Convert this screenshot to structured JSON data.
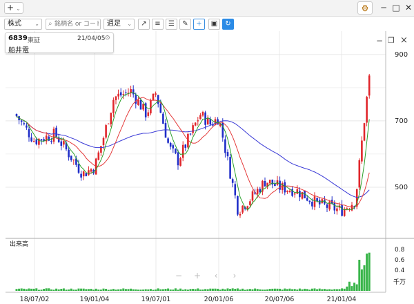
{
  "titlebar": {
    "add_label": "+",
    "gear_icon": "gear-icon",
    "min": "−",
    "max": "□",
    "close": "✕"
  },
  "toolbar": {
    "asset_type": "株式",
    "search_placeholder": "銘柄名 or コード",
    "period": "週足",
    "tools": [
      "trend-line-icon",
      "text-lines-icon",
      "align-icon",
      "pencil-icon",
      "crosshair-icon",
      "camera-icon",
      "refresh-icon"
    ]
  },
  "info": {
    "code": "6839",
    "market": "東証",
    "date": "21/04/05",
    "name": "船井電"
  },
  "volume_label": "出来高",
  "volume_unit": "千万",
  "nav": [
    "−",
    "+",
    "‹",
    "›"
  ],
  "chart_data": [
    {
      "type": "candlestick",
      "title": "",
      "y_ticks": [
        500,
        700,
        900
      ],
      "ylim": [
        350,
        960
      ],
      "x_tick_labels": [
        "18/07/02",
        "19/01/04",
        "19/07/01",
        "20/01/06",
        "20/07/06",
        "21/01/04"
      ],
      "colors": {
        "up": "#e0262b",
        "down": "#1f2dc8",
        "ma_short": "#2aa02a",
        "ma_mid": "#e43b3b",
        "ma_long": "#3a3ad6"
      },
      "ohlc_anchors": [
        {
          "x": "18/04",
          "close": 720
        },
        {
          "x": "18/07/02",
          "close": 640
        },
        {
          "x": "18/10",
          "close": 660
        },
        {
          "x": "18/12",
          "close": 540
        },
        {
          "x": "19/01/04",
          "close": 560
        },
        {
          "x": "19/02",
          "close": 650
        },
        {
          "x": "19/03",
          "close": 770
        },
        {
          "x": "19/04",
          "close": 790
        },
        {
          "x": "19/05",
          "close": 720
        },
        {
          "x": "19/07/01",
          "close": 785
        },
        {
          "x": "19/08",
          "close": 620
        },
        {
          "x": "19/09",
          "close": 580
        },
        {
          "x": "19/11",
          "close": 720
        },
        {
          "x": "19/12",
          "close": 690
        },
        {
          "x": "20/01/06",
          "close": 710
        },
        {
          "x": "20/03",
          "close": 430
        },
        {
          "x": "20/05",
          "close": 470
        },
        {
          "x": "20/06",
          "close": 520
        },
        {
          "x": "20/07/06",
          "close": 500
        },
        {
          "x": "20/09",
          "close": 490
        },
        {
          "x": "20/11",
          "close": 450
        },
        {
          "x": "21/01/04",
          "close": 430
        },
        {
          "x": "21/02",
          "close": 460
        },
        {
          "x": "21/03",
          "close": 740
        },
        {
          "x": "21/04/05",
          "close": 910
        }
      ]
    },
    {
      "type": "bar",
      "title": "出来高",
      "y_ticks": [
        0.4,
        0.6,
        0.8
      ],
      "ylim": [
        0,
        0.95
      ],
      "unit": "千万"
    }
  ]
}
